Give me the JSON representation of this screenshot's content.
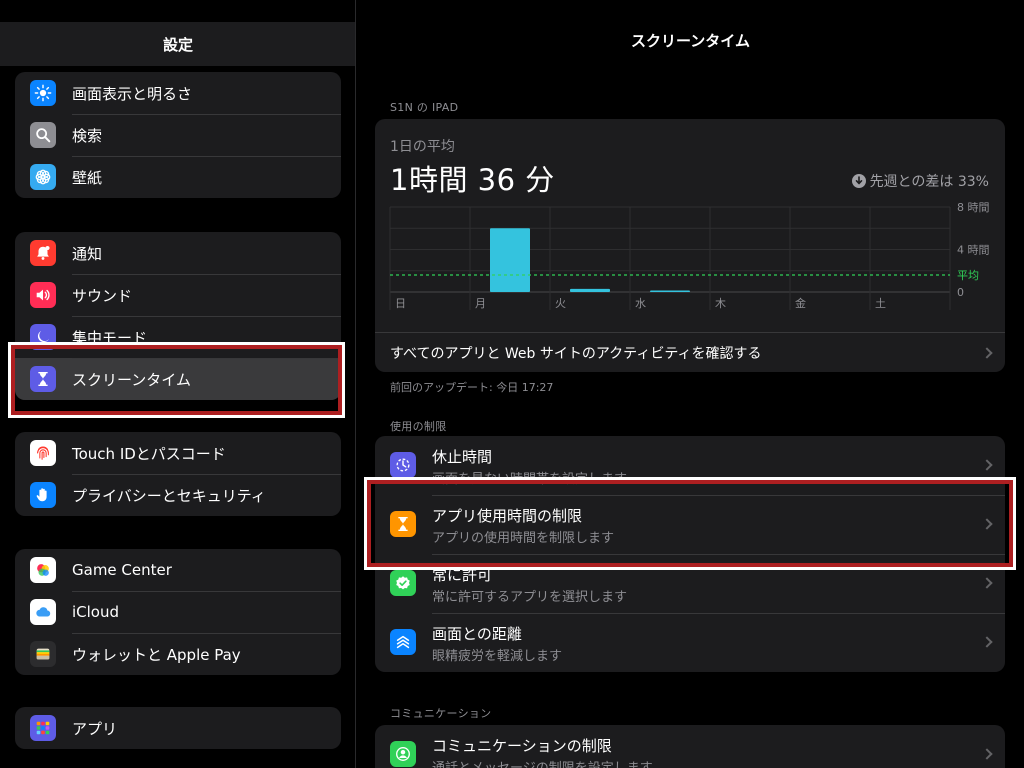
{
  "sidebar": {
    "title": "設定",
    "group1": [
      {
        "label": "画面表示と明るさ",
        "icon": "sun-icon",
        "color": "#0a84ff"
      },
      {
        "label": "検索",
        "icon": "search-icon",
        "color": "#8e8e93"
      },
      {
        "label": "壁紙",
        "icon": "flower-icon",
        "color": "#35aaf0"
      }
    ],
    "group2": [
      {
        "label": "通知",
        "icon": "bell-icon",
        "color": "#ff3b30"
      },
      {
        "label": "サウンド",
        "icon": "speaker-icon",
        "color": "#ff2d55"
      },
      {
        "label": "集中モード",
        "icon": "moon-icon",
        "color": "#5e5ce6"
      },
      {
        "label": "スクリーンタイム",
        "icon": "hourglass-icon",
        "color": "#5e5ce6"
      }
    ],
    "group3": [
      {
        "label": "Touch IDとパスコード",
        "icon": "fingerprint-icon",
        "color": "#ffffff"
      },
      {
        "label": "プライバシーとセキュリティ",
        "icon": "hand-icon",
        "color": "#0a84ff"
      }
    ],
    "group4": [
      {
        "label": "Game Center",
        "icon": "game-center-icon",
        "color": "#ffffff"
      },
      {
        "label": "iCloud",
        "icon": "cloud-icon",
        "color": "#ffffff"
      },
      {
        "label": "ウォレットと Apple Pay",
        "icon": "wallet-icon",
        "color": "#3a3a3c"
      }
    ],
    "group5": [
      {
        "label": "アプリ",
        "icon": "apps-grid-icon",
        "color": "#5e5ce6"
      }
    ]
  },
  "main": {
    "title": "スクリーンタイム",
    "device_label": "S1N の IPAD",
    "avg_label": "1日の平均",
    "avg_value": "1時間 36 分",
    "diff_text": "先週との差は 33%",
    "activity_link": "すべてのアプリと Web サイトのアクティビティを確認する",
    "updated": "前回のアップデート: 今日 17:27",
    "limits_label": "使用の制限",
    "limits": [
      {
        "title": "休止時間",
        "subtitle": "画面を見ない時間帯を設定します",
        "icon": "downtime-icon",
        "color": "#5e5ce6"
      },
      {
        "title": "アプリ使用時間の制限",
        "subtitle": "アプリの使用時間を制限します",
        "icon": "hourglass-icon",
        "color": "#ff9500"
      },
      {
        "title": "常に許可",
        "subtitle": "常に許可するアプリを選択します",
        "icon": "checkmark-seal-icon",
        "color": "#30d158"
      },
      {
        "title": "画面との距離",
        "subtitle": "眼精疲労を軽減します",
        "icon": "distance-icon",
        "color": "#0a84ff"
      }
    ],
    "comm_label": "コミュニケーション",
    "comm": {
      "title": "コミュニケーションの制限",
      "subtitle": "通話とメッセージの制限を設定します",
      "icon": "person-circle-icon",
      "color": "#30d158"
    }
  },
  "chart_data": {
    "type": "bar",
    "categories": [
      "日",
      "月",
      "火",
      "水",
      "木",
      "金",
      "土"
    ],
    "values": [
      0,
      6.0,
      0.3,
      0.1,
      0,
      0,
      0
    ],
    "y_tick_labels": [
      "8 時間",
      "4 時間",
      "0"
    ],
    "yticks": [
      8,
      4,
      0
    ],
    "ylim": [
      0,
      8
    ],
    "average": 1.6,
    "average_label": "平均",
    "bar_color": "#34c3de",
    "average_color": "#30d158"
  }
}
